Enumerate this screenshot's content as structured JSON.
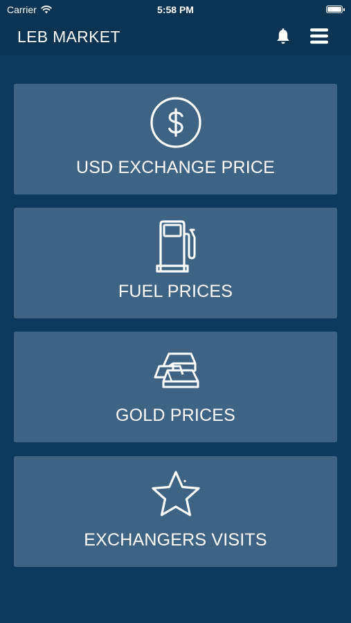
{
  "status_bar": {
    "carrier": "Carrier",
    "time": "5:58 PM",
    "wifi_icon": "wifi-icon",
    "battery_icon": "battery-icon"
  },
  "nav": {
    "title": "LEB MARKET",
    "bell_icon": "bell-icon",
    "menu_icon": "menu-icon"
  },
  "cards": [
    {
      "label": "USD EXCHANGE PRICE",
      "icon": "dollar-circle-icon"
    },
    {
      "label": "FUEL PRICES",
      "icon": "fuel-pump-icon"
    },
    {
      "label": "GOLD PRICES",
      "icon": "gold-bars-icon"
    },
    {
      "label": "EXCHANGERS VISITS",
      "icon": "star-icon"
    }
  ],
  "colors": {
    "background": "#0c3a5e",
    "bar": "#0a3452",
    "card": "#3f6483",
    "text": "#ffffff"
  }
}
